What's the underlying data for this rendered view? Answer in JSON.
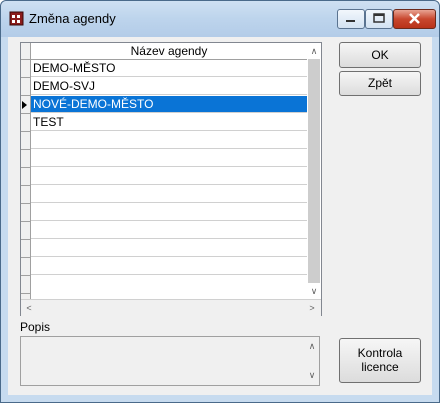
{
  "window": {
    "title": "Změna agendy"
  },
  "grid": {
    "column_header": "Název agendy",
    "rows": [
      "DEMO-MĚSTO",
      "DEMO-SVJ",
      "NOVÉ-DEMO-MĚSTO",
      "TEST"
    ],
    "selected_index": 2
  },
  "description": {
    "label": "Popis",
    "value": ""
  },
  "buttons": {
    "ok": "OK",
    "back": "Zpět",
    "license_line1": "Kontrola",
    "license_line2": "licence"
  },
  "icons": {
    "app": "calendar-grid-icon",
    "minimize": "minimize-icon",
    "maximize": "maximize-icon",
    "close": "close-icon"
  },
  "colors": {
    "selection": "#0a74d6",
    "titlebar": "#c7dbef",
    "close": "#c8472e"
  }
}
